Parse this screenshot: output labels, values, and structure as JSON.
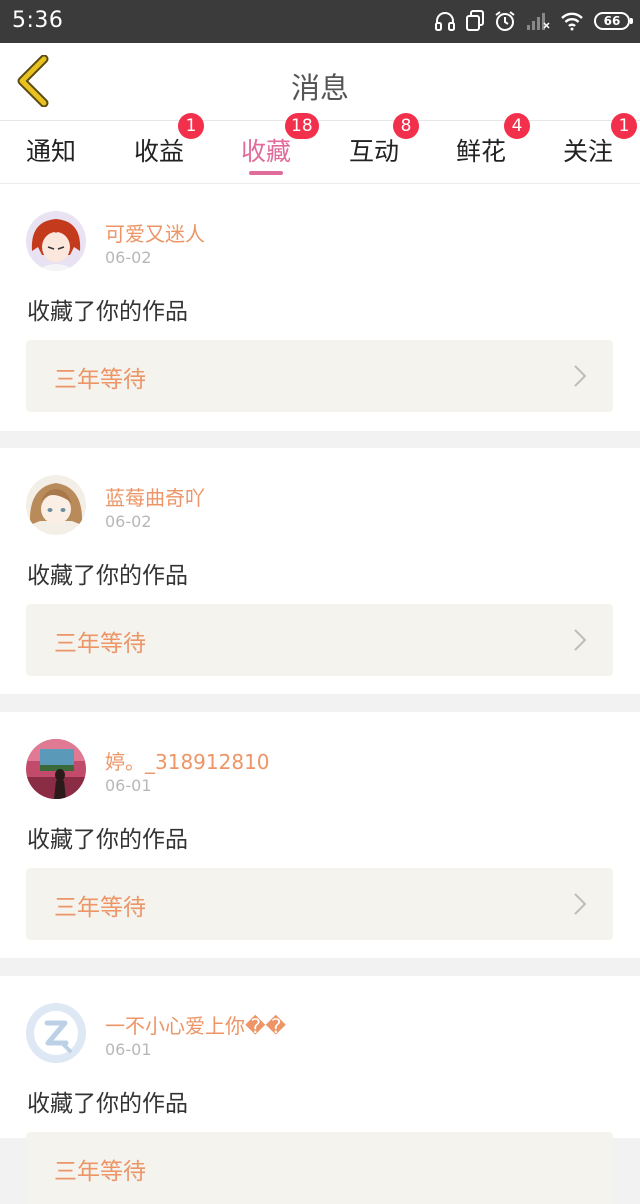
{
  "status_bar": {
    "time": "5:36",
    "battery": "66"
  },
  "header": {
    "title": "消息"
  },
  "tabs": [
    {
      "label": "通知",
      "badge": ""
    },
    {
      "label": "收益",
      "badge": "1"
    },
    {
      "label": "收藏",
      "badge": "18",
      "active": true
    },
    {
      "label": "互动",
      "badge": "8"
    },
    {
      "label": "鲜花",
      "badge": "4"
    },
    {
      "label": "关注",
      "badge": "1"
    }
  ],
  "messages": [
    {
      "user": "可爱又迷人",
      "date": "06-02",
      "action": "收藏了你的作品",
      "work": "三年等待",
      "avatar_icon": "anime-girl-red-hair"
    },
    {
      "user": "蓝莓曲奇吖",
      "date": "06-02",
      "action": "收藏了你的作品",
      "work": "三年等待",
      "avatar_icon": "anime-girl-brown-hair"
    },
    {
      "user": "婷。_318912810",
      "date": "06-01",
      "action": "收藏了你的作品",
      "work": "三年等待",
      "avatar_icon": "photo-landscape"
    },
    {
      "user": "一不小心爱上你��",
      "date": "06-01",
      "action": "收藏了你的作品",
      "work": "三年等待",
      "avatar_icon": "default-avatar-z"
    }
  ],
  "colors": {
    "accent": "#e16b9a",
    "username": "#ed9566",
    "badge": "#f2304b",
    "back_arrow": "#e8c21f"
  }
}
